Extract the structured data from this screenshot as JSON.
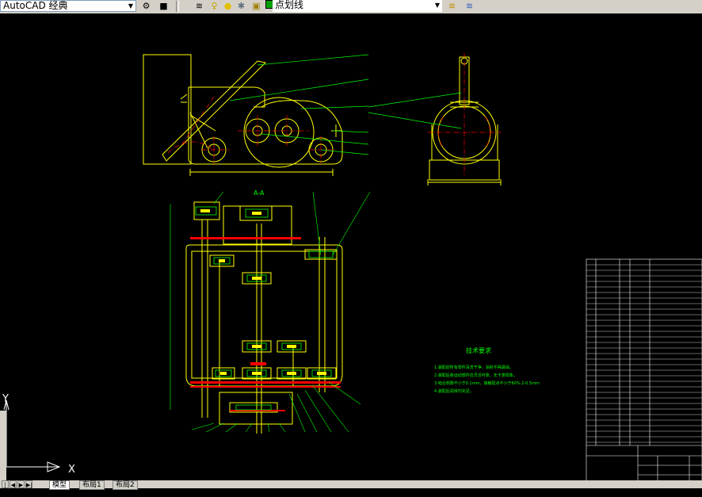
{
  "toolbar": {
    "workspace_value": "AutoCAD 经典",
    "linetype_value": "点划线",
    "layer_color": "#00a000"
  },
  "drawing": {
    "section_label": "A-A",
    "tech_title": "技术要求",
    "tech_notes": [
      "1.装配前所有零件清洗干净，油封不得漏油。",
      "2.装配后各运动部件应灵活可靠，无卡滞现象。",
      "3.啮合侧隙不小于0.1mm，接触斑点不小于60%.2-0.5mm",
      "4.装配后润滑剂充足。"
    ]
  },
  "ucs": {
    "x_label": "X",
    "y_label": "Y"
  },
  "tabs": [
    "模型",
    "布局1",
    "布局2"
  ],
  "colors": {
    "line": "#ffff00",
    "center": "#ff0000",
    "dim": "#00ff00",
    "bg": "#000000"
  }
}
